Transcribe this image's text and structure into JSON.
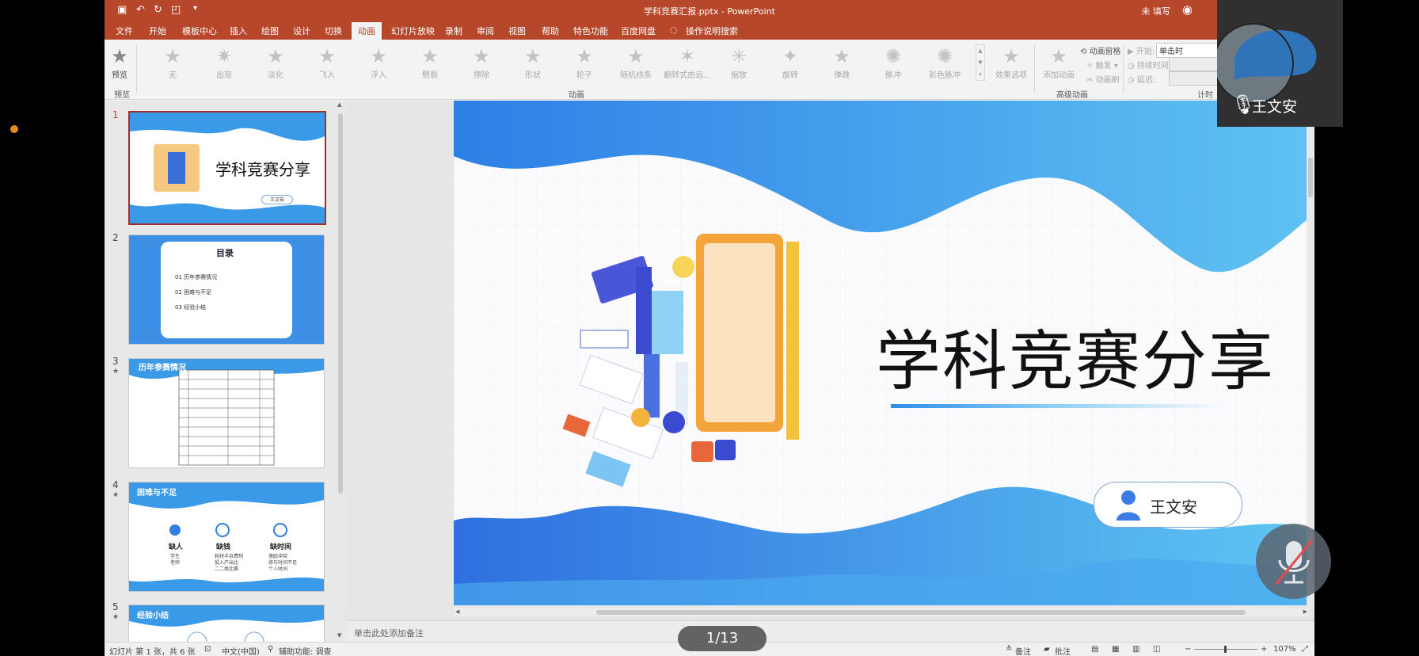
{
  "window": {
    "doc_title": "学科竞赛汇报.pptx  -  PowerPoint",
    "login": "未 填写"
  },
  "menu": {
    "tabs": [
      "文件",
      "开始",
      "模板中心",
      "插入",
      "绘图",
      "设计",
      "切换",
      "动画",
      "幻灯片放映",
      "录制",
      "审阅",
      "视图",
      "帮助",
      "特色功能",
      "百度网盘"
    ],
    "active": "动画",
    "search": "操作说明搜索"
  },
  "ribbon": {
    "preview_label": "预览",
    "preview_group": "预览",
    "animations": [
      "无",
      "出现",
      "淡化",
      "飞入",
      "浮入",
      "劈裂",
      "擦除",
      "形状",
      "轮子",
      "随机线条",
      "翻转式由远...",
      "缩放",
      "旋转",
      "弹跳",
      "脉冲",
      "彩色脉冲"
    ],
    "effect_options": "效果选项",
    "animation_group": "动画",
    "add_animation": "添加动画",
    "animation_pane": "动画窗格",
    "trigger": "触发",
    "animation_painter": "动画刷",
    "advanced_group": "高级动画",
    "start_label": "开始:",
    "start_value": "单击时",
    "duration_label": "持续时间:",
    "delay_label": "延迟:",
    "timing_group": "计时"
  },
  "thumbs": {
    "slides": [
      {
        "num": "1",
        "title": "学科竞赛分享",
        "badge": "王文安"
      },
      {
        "num": "2",
        "title": "目录",
        "items": [
          "01  历年参赛情况",
          "02  困难与不足",
          "03  经验小结"
        ]
      },
      {
        "num": "3",
        "title": "历年参赛情况"
      },
      {
        "num": "4",
        "title": "困难与不足",
        "cols": [
          {
            "h": "缺人",
            "t": "学生\n老师"
          },
          {
            "h": "缺钱",
            "t": "耗材半自费制\n投入产出比\n二二类比赛"
          },
          {
            "h": "缺时间",
            "t": "激励冲突\n修与时间不足\n个人时间"
          }
        ]
      },
      {
        "num": "5",
        "title": "经验小结"
      }
    ]
  },
  "slide": {
    "title": "学科竞赛分享",
    "presenter": "王文安"
  },
  "notes_placeholder": "单击此处添加备注",
  "status": {
    "slide_info": "幻灯片 第 1 张，共 6 张",
    "language": "中文(中国)",
    "accessibility": "辅助功能: 调查",
    "notes": "备注",
    "comments": "批注",
    "zoom": "107%"
  },
  "pager": "1/13",
  "video": {
    "name": "王文安"
  },
  "colors": {
    "accent": "#b7472a",
    "slide_blue": "#3a8fe8"
  }
}
